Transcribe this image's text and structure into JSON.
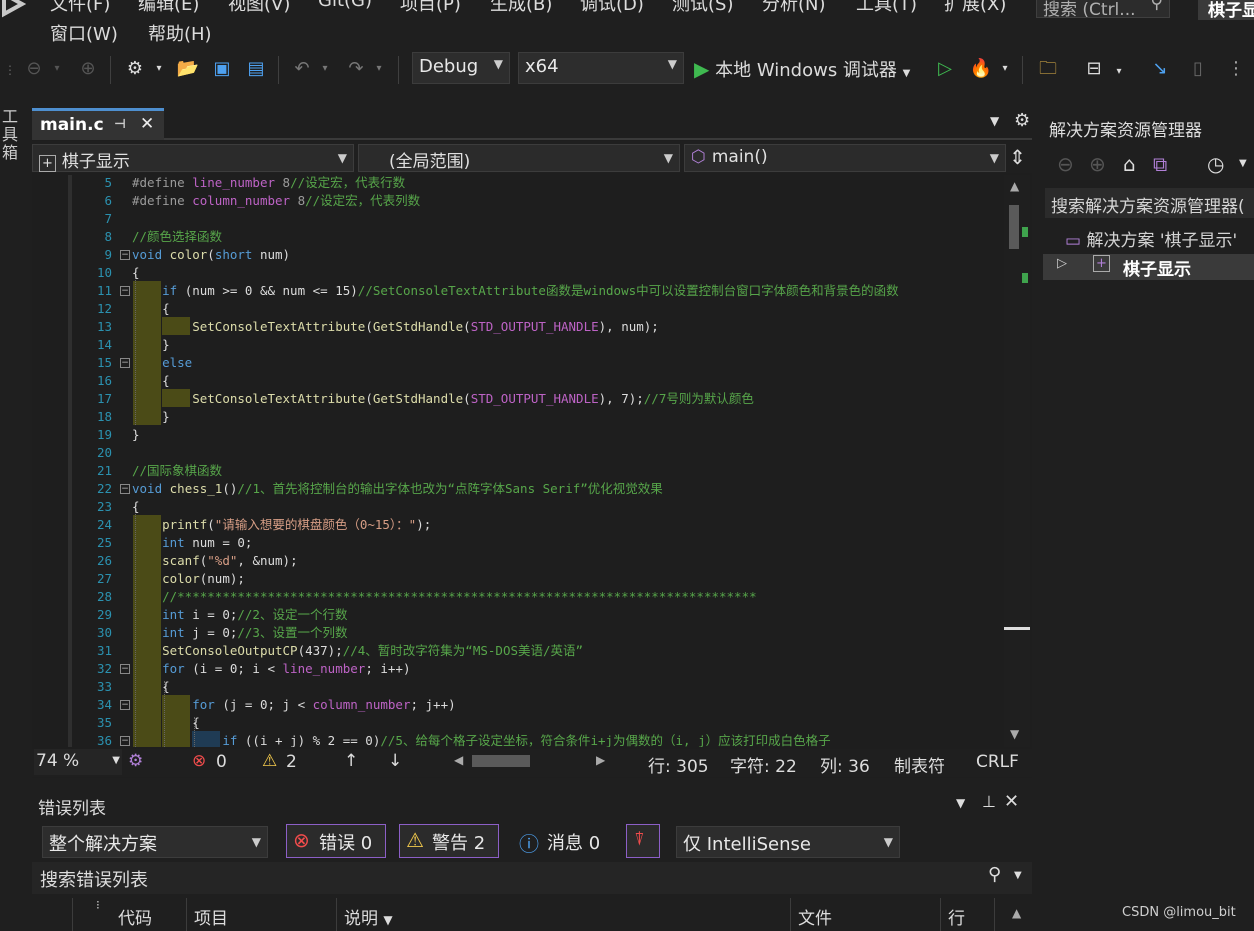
{
  "menubar": {
    "items": [
      "文件(F)",
      "编辑(E)",
      "视图(V)",
      "Git(G)",
      "项目(P)",
      "生成(B)",
      "调试(D)",
      "测试(S)",
      "分析(N)",
      "工具(T)",
      "扩展(X)"
    ],
    "row2": [
      "窗口(W)",
      "帮助(H)"
    ],
    "search_placeholder": "搜索 (Ctrl...",
    "project_tab": "棋子显"
  },
  "toolbar": {
    "config": "Debug",
    "platform": "x64",
    "run_label": "本地 Windows 调试器"
  },
  "toolbox_label": "工具箱",
  "editor": {
    "tab_label": "main.c",
    "nav_project": "棋子显示",
    "nav_scope": "(全局范围)",
    "nav_member": "main()",
    "lines": [
      {
        "n": "5",
        "html": "<span class=\"pp\">#define</span> <span class=\"mac\">line_number</span> <span class=\"pp\">8</span><span class=\"cm\">//设定宏，代表行数</span>"
      },
      {
        "n": "6",
        "html": "<span class=\"pp\">#define</span> <span class=\"mac\">column_number</span> <span class=\"pp\">8</span><span class=\"cm\">//设定宏，代表列数</span>"
      },
      {
        "n": "7",
        "html": ""
      },
      {
        "n": "8",
        "html": "<span class=\"cm\">//颜色选择函数</span>"
      },
      {
        "n": "9",
        "html": "<span class=\"kw\">void</span> <span class=\"fn\">color</span>(<span class=\"kw\">short</span> num)"
      },
      {
        "n": "10",
        "html": "{"
      },
      {
        "n": "11",
        "html": "    <span class=\"kw\">if</span> (num &gt;= 0 &amp;&amp; num &lt;= 15)<span class=\"cm\">//SetConsoleTextAttribute函数是windows中可以设置控制台窗口字体颜色和背景色的函数</span>"
      },
      {
        "n": "12",
        "html": "    {"
      },
      {
        "n": "13",
        "html": "        <span class=\"fn\">SetConsoleTextAttribute</span>(<span class=\"fn\">GetStdHandle</span>(<span class=\"mac\">STD_OUTPUT_HANDLE</span>), num);"
      },
      {
        "n": "14",
        "html": "    }"
      },
      {
        "n": "15",
        "html": "    <span class=\"kw\">else</span>"
      },
      {
        "n": "16",
        "html": "    {"
      },
      {
        "n": "17",
        "html": "        <span class=\"fn\">SetConsoleTextAttribute</span>(<span class=\"fn\">GetStdHandle</span>(<span class=\"mac\">STD_OUTPUT_HANDLE</span>), 7);<span class=\"cm\">//7号则为默认颜色</span>"
      },
      {
        "n": "18",
        "html": "    }"
      },
      {
        "n": "19",
        "html": "}"
      },
      {
        "n": "20",
        "html": ""
      },
      {
        "n": "21",
        "html": "<span class=\"cm\">//国际象棋函数</span>"
      },
      {
        "n": "22",
        "html": "<span class=\"kw\">void</span> <span class=\"fn\">chess_1</span>()<span class=\"cm\">//1、首先将控制台的输出字体也改为“点阵字体Sans Serif”优化视觉效果</span>"
      },
      {
        "n": "23",
        "html": "{"
      },
      {
        "n": "24",
        "html": "    <span class=\"fn\">printf</span>(<span class=\"st\">\"请输入想要的棋盘颜色（0~15）：\"</span>);"
      },
      {
        "n": "25",
        "html": "    <span class=\"kw\">int</span> num = 0;"
      },
      {
        "n": "26",
        "html": "    <span class=\"fn\">scanf</span>(<span class=\"st\">\"%d\"</span>, &amp;num);"
      },
      {
        "n": "27",
        "html": "    <span class=\"fn\">color</span>(num);"
      },
      {
        "n": "28",
        "html": "    <span class=\"cm\">//*****************************************************************************</span>"
      },
      {
        "n": "29",
        "html": "    <span class=\"kw\">int</span> i = 0;<span class=\"cm\">//2、设定一个行数</span>"
      },
      {
        "n": "30",
        "html": "    <span class=\"kw\">int</span> j = 0;<span class=\"cm\">//3、设置一个列数</span>"
      },
      {
        "n": "31",
        "html": "    <span class=\"fn\">SetConsoleOutputCP</span>(437);<span class=\"cm\">//4、暂时改字符集为“MS-DOS美语/英语”</span>"
      },
      {
        "n": "32",
        "html": "    <span class=\"kw\">for</span> (i = 0; i &lt; <span class=\"mac\">line_number</span>; i++)"
      },
      {
        "n": "33",
        "html": "    {"
      },
      {
        "n": "34",
        "html": "        <span class=\"kw\">for</span> (j = 0; j &lt; <span class=\"mac\">column_number</span>; j++)"
      },
      {
        "n": "35",
        "html": "        {"
      },
      {
        "n": "36",
        "html": "            <span class=\"kw\">if</span> ((i + j) % 2 == 0)<span class=\"cm\">//5、给每个格子设定坐标，符合条件i+j为偶数的（i, j）应该打印成白色格子</span>"
      }
    ]
  },
  "status": {
    "zoom": "74 %",
    "errors": "0",
    "warnings": "2",
    "line": "行: 305",
    "char": "字符: 22",
    "col": "列: 36",
    "tab": "制表符",
    "eol": "CRLF"
  },
  "solution_explorer": {
    "title": "解决方案资源管理器",
    "search": "搜索解决方案资源管理器(",
    "solution": "解决方案 '棋子显示'",
    "project": "棋子显示"
  },
  "error_list": {
    "title": "错误列表",
    "scope": "整个解决方案",
    "errors_badge": "错误 0",
    "warnings_badge": "警告 2",
    "messages_badge": "消息 0",
    "build_filter": "仅 IntelliSense",
    "search": "搜索错误列表",
    "columns": [
      "代码",
      "项目",
      "说明",
      "文件",
      "行"
    ]
  },
  "watermark": "CSDN @limou_bit",
  "colors": {
    "accent": "#4e8fcf",
    "comment": "#57a64a",
    "keyword": "#569cd6",
    "error": "#e81123",
    "warning": "#f2c94c"
  }
}
